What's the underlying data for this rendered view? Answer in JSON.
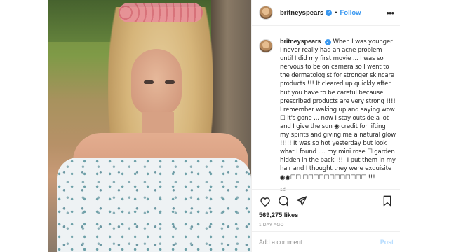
{
  "post": {
    "username": "britneyspears",
    "follow_label": "Follow",
    "caption_text": "When I was younger I never really had an acne problem until I did my first movie ... I was so nervous to be on camera so I went to the dermatologist for stronger skincare products !!! It cleared up quickly after but you have to be careful because prescribed products are very strong !!!! I remember waking up and saying wow ☐ it's gone ... now I stay outside a lot and I give the sun ◉ credit for lifting my spirits and giving me a natural glow !!!!! It was so hot yesterday but look what I found .... my mini rose ☐ garden hidden in the back !!!! I put them in my hair and I thought they were exquisite ◉◉☐☐ ☐☐☐☐☐☐☐☐☐☐☐☐ !!!",
    "caption_age": "1d",
    "likes": "569,275 likes",
    "time_ago": "1 DAY AGO",
    "comment_placeholder": "Add a comment...",
    "post_label": "Post"
  },
  "icons": {
    "header_more": "more-options-icon",
    "verified": "verified-badge-icon",
    "like": "heart-icon",
    "comment": "comment-bubble-icon",
    "share": "share-send-icon",
    "save": "bookmark-icon"
  },
  "colors": {
    "link_blue": "#3897f0",
    "post_disabled": "#b3dbff",
    "text": "#262626",
    "muted": "#8e8e8e"
  }
}
